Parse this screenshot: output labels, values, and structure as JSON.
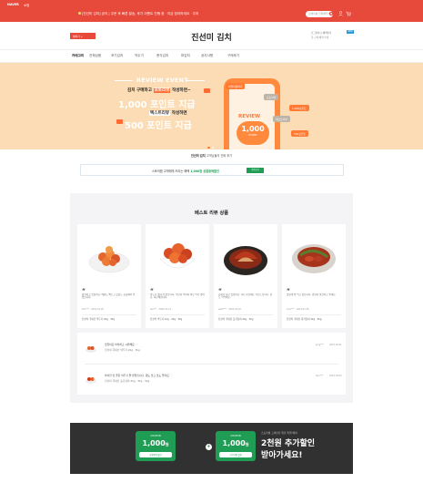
{
  "topbar": {
    "brand": "NAVER",
    "brand2": "쇼핑",
    "notice": "[진선미 김치] 공지 | 주문 후 빠른 발송, 후기 이벤트 진행 중 · 지금 참여하세요 · 주의",
    "search_placeholder": "검색어를 입력해주세요"
  },
  "header": {
    "favorite_label": "찜하기 +",
    "logo": "진선미 김치",
    "login_text": "로그인하고 혜택받기",
    "login_badge": "NEW",
    "promo_text": "첫 구매 혜택 안내"
  },
  "nav": {
    "items": [
      "카테고리",
      "전체상품",
      "포기김치",
      "깍두기",
      "총각김치",
      "파김치",
      "공지사항",
      "구매후기"
    ]
  },
  "banner": {
    "event_title": "REVIEW EVENT",
    "line1_a": "김치 구매",
    "line1_b": "하고",
    "line1_c": "포토리뷰",
    "line1_d": "작성",
    "line1_e": "하면~",
    "line2": "1,000 포인트 지급",
    "line3_a": "텍스트리뷰",
    "line3_b": "작성하면",
    "line4": "500 포인트 지급",
    "review_label": "REVIEW",
    "point_value": "1,000",
    "point_unit": "POINT",
    "tags": [
      "리뷰작성하기",
      "포토리뷰",
      "1,000포인트",
      "텍스트리뷰",
      "500포인트"
    ]
  },
  "caption": {
    "bold": "진선미 김치",
    "rest": "고객님들의 진짜 후기"
  },
  "coupon_strip": {
    "text_a": "스토어찜 고객에게 드리는 혜택",
    "text_b": "1,000원 상품중복할인",
    "button": "쿠폰받기"
  },
  "best": {
    "title": "베스트 리뷰 상품",
    "cards": [
      {
        "quote": "“",
        "text": "아삭하고 맛있어요. 배송도 빠르고 포장도 꼼꼼해서 좋았습니다.",
        "user": "kim***",
        "date": "2021.01.05",
        "product": "진선미 국내산 깍두기 2kg · 3kg"
      },
      {
        "quote": "“",
        "text": "깍두기 맛이 딱 좋습니다. 적당히 익어서 바로 먹기 좋아요. 재구매합니다.",
        "user": "lee***",
        "date": "2021.01.12",
        "product": "진선미 깍두기 1kg · 2kg · 3kg"
      },
      {
        "quote": "“",
        "text": "김치가 너무 맛있어요. 다른 분들께도 추천드립니다. 양도 넉넉해요.",
        "user": "park***",
        "date": "2021.01.20",
        "product": "진선미 국내산 포기김치 2kg · 3kg"
      },
      {
        "quote": "“",
        "text": "맛있게 잘 먹고 있습니다. 양념이 깔끔하고 좋네요.",
        "user": "choi***",
        "date": "2021.01.28",
        "product": "진선미 국내산 총각김치 2kg · 3kg"
      }
    ]
  },
  "review_list": [
    {
      "t1": "맛있어요 아삭하고 시원해요",
      "t2": "진선미 국내산 깍두기 2kg · 3kg",
      "user": "jung***",
      "date": "2021.02.01"
    },
    {
      "t1": "아삭한 맛 좋은 깍두기 잘 받았습니다. 양도 많고 맛도 좋아요.",
      "t2": "진선미 국내산 포기김치 2kg · 3kg · 5kg",
      "user": "han***",
      "date": "2021.02.03"
    }
  ],
  "bottom": {
    "coupons": [
      {
        "c1": "COUPON",
        "c2": "1,000",
        "unit": "원",
        "c3": "상품중복할인"
      },
      {
        "c1": "COUPON",
        "c2": "1,000",
        "unit": "원",
        "c3": "스토어찜 할인"
      }
    ],
    "plus": "+",
    "sub": "스토어찜 고객만을 위한 특별 혜택",
    "main1": "2천원 추가할인",
    "main2": "받아가세요!"
  }
}
